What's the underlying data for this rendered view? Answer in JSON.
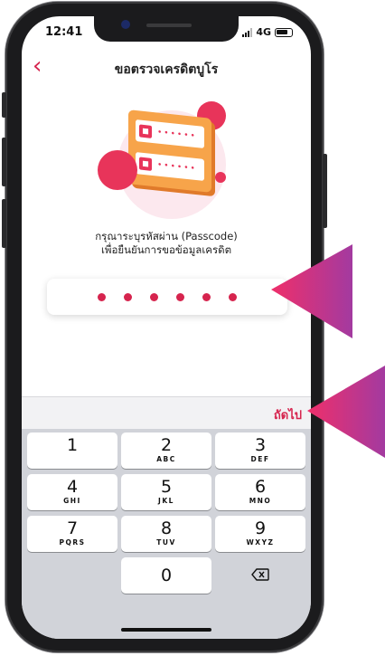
{
  "status_bar": {
    "time": "12:41",
    "network": "4G"
  },
  "header": {
    "title": "ขอตรวจเครดิตบูโร",
    "back_label": "‹"
  },
  "prompt": {
    "line1": "กรุณาระบุรหัสผ่าน (Passcode)",
    "line2": "เพื่อยืนยันการขอข้อมูลเครดิต"
  },
  "passcode": {
    "length": 6,
    "filled": 6
  },
  "keyboard": {
    "next_label": "ถัดไป",
    "keys": [
      {
        "num": "1",
        "sub": ""
      },
      {
        "num": "2",
        "sub": "ABC"
      },
      {
        "num": "3",
        "sub": "DEF"
      },
      {
        "num": "4",
        "sub": "GHI"
      },
      {
        "num": "5",
        "sub": "JKL"
      },
      {
        "num": "6",
        "sub": "MNO"
      },
      {
        "num": "7",
        "sub": "PQRS"
      },
      {
        "num": "8",
        "sub": "TUV"
      },
      {
        "num": "9",
        "sub": "WXYZ"
      },
      {
        "num": "0",
        "sub": ""
      }
    ]
  },
  "colors": {
    "accent": "#d6244e",
    "pointer": "#e8345a"
  }
}
